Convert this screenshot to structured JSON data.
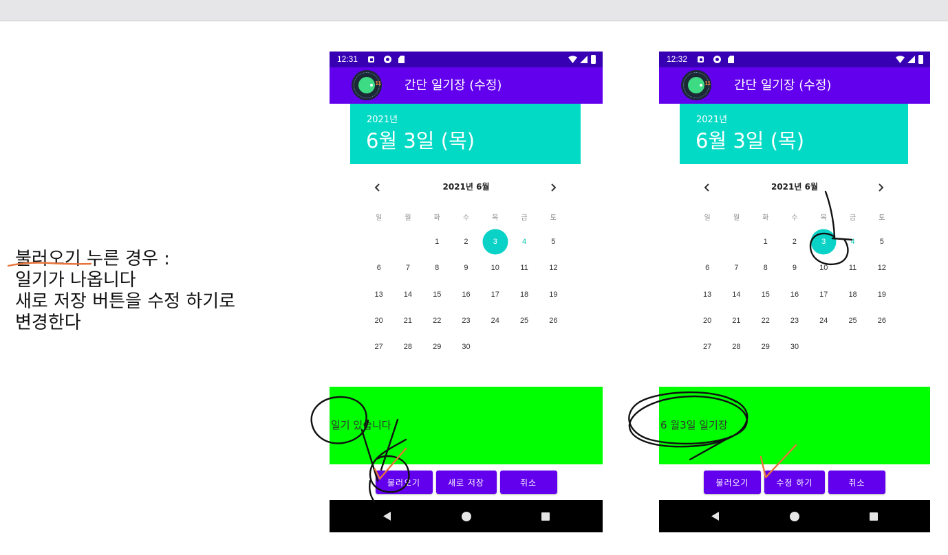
{
  "colors": {
    "window_bar": "#e6e6e8",
    "status_bar": "#3700b3",
    "toolbar": "#6200ee",
    "date_header": "#03dac5",
    "diary_box": "#00ff00",
    "button": "#6200ee",
    "nav_bar": "#000000",
    "selected_day": "#0ad2c7",
    "annotation_ink": "#111111",
    "annotation_orange": "#e8743b"
  },
  "left_note": {
    "lines": [
      "불러오기 누른 경우 :",
      "일기가 나옵니다",
      "새로 저장 버튼을 수정 하기로",
      "변경한다"
    ]
  },
  "phones": [
    {
      "status_bar": {
        "time": "12:31",
        "left_icons": [
          "notification-icon",
          "vpn-icon",
          "sd-card-icon"
        ],
        "right_icons": [
          "wifi-icon",
          "signal-icon",
          "battery-icon"
        ]
      },
      "toolbar": {
        "logo_icon": "android-11-logo-icon",
        "logo_text": "11",
        "title": "간단 일기장 (수정)"
      },
      "date_header": {
        "year": "2021년",
        "date": "6월 3일 (목)"
      },
      "calendar": {
        "month_label": "2021년 6월",
        "prev_icon": "chevron-left-icon",
        "next_icon": "chevron-right-icon",
        "weekdays": [
          "일",
          "월",
          "화",
          "수",
          "목",
          "금",
          "토"
        ],
        "weeks": [
          [
            "",
            "",
            "1",
            "2",
            "3",
            "4",
            "5"
          ],
          [
            "6",
            "7",
            "8",
            "9",
            "10",
            "11",
            "12"
          ],
          [
            "13",
            "14",
            "15",
            "16",
            "17",
            "18",
            "19"
          ],
          [
            "20",
            "21",
            "22",
            "23",
            "24",
            "25",
            "26"
          ],
          [
            "27",
            "28",
            "29",
            "30",
            "",
            "",
            ""
          ]
        ],
        "selected_day": "3",
        "today_day": "4"
      },
      "diary_text": "일기 있습니다",
      "buttons": [
        {
          "label": "불러오기"
        },
        {
          "label": "새로 저장"
        },
        {
          "label": "취소"
        }
      ],
      "nav_icons": [
        "back-icon",
        "home-icon",
        "recents-icon"
      ]
    },
    {
      "status_bar": {
        "time": "12:32",
        "left_icons": [
          "notification-icon",
          "vpn-icon",
          "sd-card-icon"
        ],
        "right_icons": [
          "wifi-icon",
          "signal-icon",
          "battery-icon"
        ]
      },
      "toolbar": {
        "logo_icon": "android-11-logo-icon",
        "logo_text": "11",
        "title": "간단 일기장 (수정)"
      },
      "date_header": {
        "year": "2021년",
        "date": "6월 3일 (목)"
      },
      "calendar": {
        "month_label": "2021년 6월",
        "prev_icon": "chevron-left-icon",
        "next_icon": "chevron-right-icon",
        "weekdays": [
          "일",
          "월",
          "화",
          "수",
          "목",
          "금",
          "토"
        ],
        "weeks": [
          [
            "",
            "",
            "1",
            "2",
            "3",
            "4",
            "5"
          ],
          [
            "6",
            "7",
            "8",
            "9",
            "10",
            "11",
            "12"
          ],
          [
            "13",
            "14",
            "15",
            "16",
            "17",
            "18",
            "19"
          ],
          [
            "20",
            "21",
            "22",
            "23",
            "24",
            "25",
            "26"
          ],
          [
            "27",
            "28",
            "29",
            "30",
            "",
            "",
            ""
          ]
        ],
        "selected_day": "3",
        "today_day": "4"
      },
      "diary_text": "6 월3일 일기장",
      "buttons": [
        {
          "label": "불러오기"
        },
        {
          "label": "수정 하기"
        },
        {
          "label": "취소"
        }
      ],
      "nav_icons": [
        "back-icon",
        "home-icon",
        "recents-icon"
      ]
    }
  ]
}
